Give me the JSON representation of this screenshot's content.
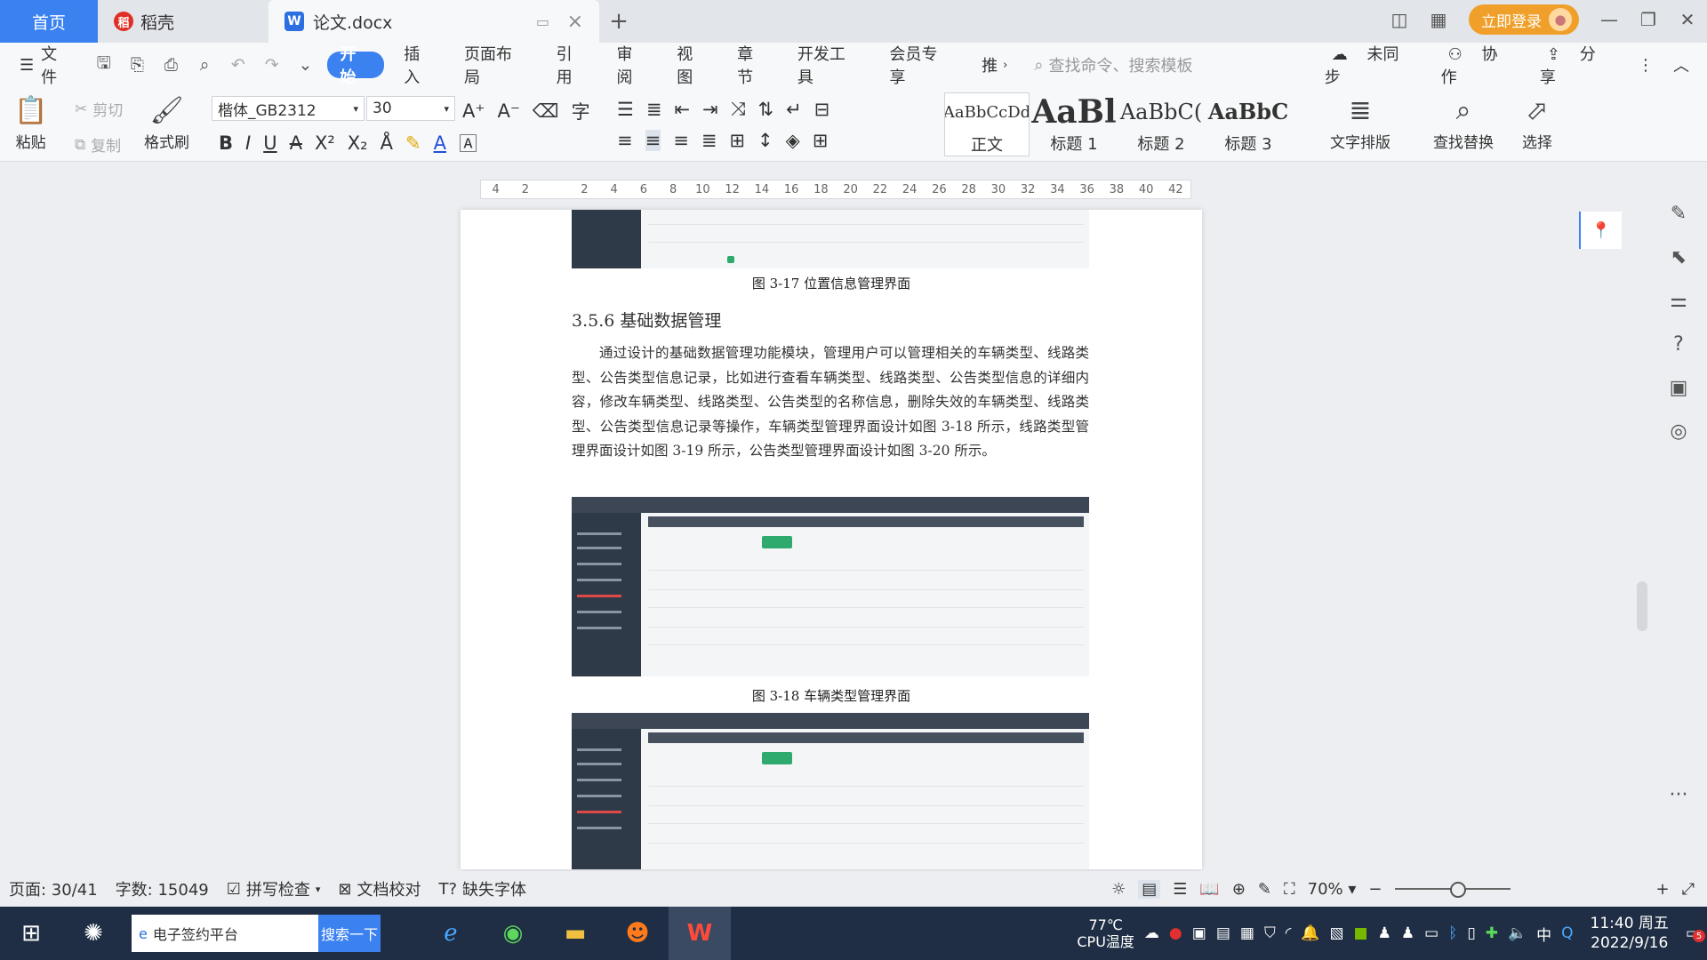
{
  "tabs": {
    "home": "首页",
    "daoke": "稻壳",
    "doc": "论文.docx"
  },
  "titlebar": {
    "login": "立即登录"
  },
  "menu": {
    "file": "文件",
    "items": [
      "开始",
      "插入",
      "页面布局",
      "引用",
      "审阅",
      "视图",
      "章节",
      "开发工具",
      "会员专享",
      "推"
    ],
    "search_placeholder": "查找命令、搜索模板",
    "sync": "未同步",
    "collab": "协作",
    "share": "分享"
  },
  "ribbon": {
    "paste": "粘贴",
    "cut": "剪切",
    "copy": "复制",
    "format_painter": "格式刷",
    "font": "楷体_GB2312",
    "size": "30",
    "styles": [
      {
        "preview": "AaBbCcDd",
        "label": "正文"
      },
      {
        "preview": "AaBl",
        "label": "标题 1"
      },
      {
        "preview": "AaBbC(",
        "label": "标题 2"
      },
      {
        "preview": "AaBbC",
        "label": "标题 3"
      }
    ],
    "layout": "文字排版",
    "find_replace": "查找替换",
    "select": "选择"
  },
  "ruler": {
    "ticks": [
      "4",
      "2",
      "",
      "2",
      "4",
      "6",
      "8",
      "10",
      "12",
      "14",
      "16",
      "18",
      "20",
      "22",
      "24",
      "26",
      "28",
      "30",
      "32",
      "34",
      "36",
      "38",
      "40",
      "42"
    ]
  },
  "document": {
    "caption_top": "图 3-17  位置信息管理界面",
    "heading": "3.5.6  基础数据管理",
    "paragraph": "通过设计的基础数据管理功能模块，管理用户可以管理相关的车辆类型、线路类型、公告类型信息记录，比如进行查看车辆类型、线路类型、公告类型信息的详细内容，修改车辆类型、线路类型、公告类型的名称信息，删除失效的车辆类型、线路类型、公告类型信息记录等操作，车辆类型管理界面设计如图 3-18 所示，线路类型管理界面设计如图 3-19 所示，公告类型管理界面设计如图 3-20 所示。",
    "caption_mid": "图 3-18  车辆类型管理界面"
  },
  "status": {
    "page": "页面: 30/41",
    "words": "字数: 15049",
    "spell": "拼写检查",
    "proof": "文档校对",
    "missing_font": "缺失字体",
    "zoom": "70%"
  },
  "taskbar": {
    "search_text": "电子签约平台",
    "search_btn": "搜索一下",
    "temp": "77℃",
    "temp_label": "CPU温度",
    "ime": "中",
    "time": "11:40 周五",
    "date": "2022/9/16",
    "badge": "5"
  }
}
